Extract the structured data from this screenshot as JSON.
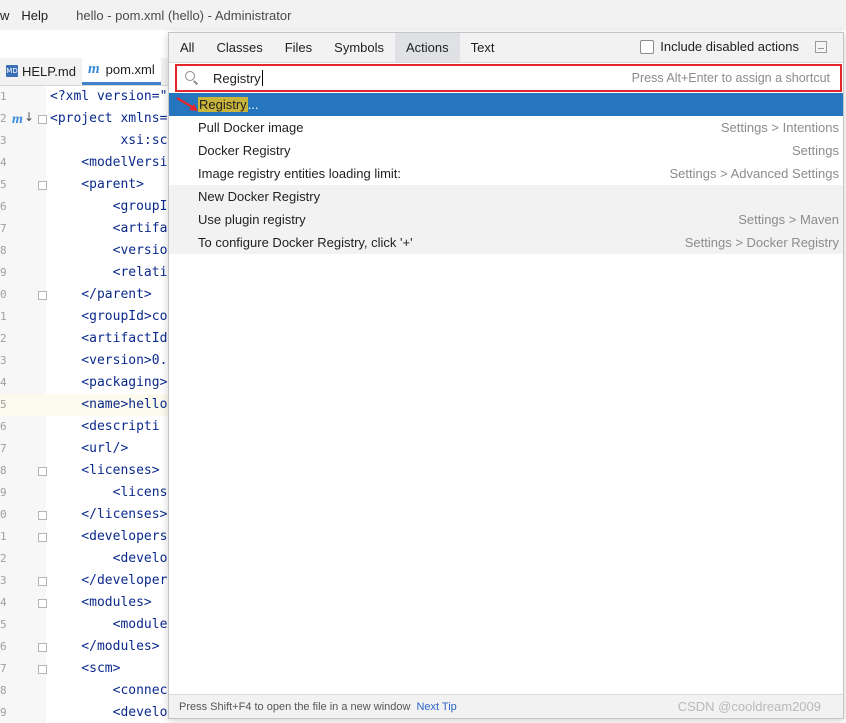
{
  "window": {
    "menus": [
      "w",
      "Help"
    ],
    "title": "hello - pom.xml (hello) - Administrator"
  },
  "editor_tabs": [
    {
      "icon": "md",
      "label": "HELP.md"
    },
    {
      "icon": "m",
      "label": "pom.xml"
    }
  ],
  "code_lines": [
    {
      "ln": "1",
      "text": "<?xml version=\""
    },
    {
      "ln": "2",
      "text": "<project xmlns="
    },
    {
      "ln": "3",
      "text": "         xsi:sc"
    },
    {
      "ln": "4",
      "text": "    <modelVersi"
    },
    {
      "ln": "5",
      "text": "    <parent>"
    },
    {
      "ln": "6",
      "text": "        <groupI"
    },
    {
      "ln": "7",
      "text": "        <artifa"
    },
    {
      "ln": "8",
      "text": "        <versio"
    },
    {
      "ln": "9",
      "text": "        <relati"
    },
    {
      "ln": "0",
      "text": "    </parent>"
    },
    {
      "ln": "1",
      "text": "    <groupId>co"
    },
    {
      "ln": "2",
      "text": "    <artifactId"
    },
    {
      "ln": "3",
      "text": "    <version>0."
    },
    {
      "ln": "4",
      "text": "    <packaging>"
    },
    {
      "ln": "5",
      "text": "    <name>hello"
    },
    {
      "ln": "6",
      "text": "    <descripti"
    },
    {
      "ln": "7",
      "text": "    <url/>"
    },
    {
      "ln": "8",
      "text": "    <licenses>"
    },
    {
      "ln": "9",
      "text": "        <licens"
    },
    {
      "ln": "0",
      "text": "    </licenses>"
    },
    {
      "ln": "1",
      "text": "    <developers"
    },
    {
      "ln": "2",
      "text": "        <develo"
    },
    {
      "ln": "3",
      "text": "    </developer"
    },
    {
      "ln": "4",
      "text": "    <modules>"
    },
    {
      "ln": "5",
      "text": "        <module"
    },
    {
      "ln": "6",
      "text": "    </modules>"
    },
    {
      "ln": "7",
      "text": "    <scm>"
    },
    {
      "ln": "8",
      "text": "        <connec"
    },
    {
      "ln": "9",
      "text": "        <develo"
    }
  ],
  "popup": {
    "tabs": [
      "All",
      "Classes",
      "Files",
      "Symbols",
      "Actions",
      "Text"
    ],
    "active_tab": "Actions",
    "include_disabled_label": "Include disabled actions",
    "search_value": "Registry",
    "search_hint": "Press Alt+Enter to assign a shortcut",
    "results": [
      {
        "match": "Registry",
        "tail": "...",
        "hint": ""
      },
      {
        "label": "Pull Docker image",
        "hint": "Settings > Intentions"
      },
      {
        "label": "Docker Registry",
        "hint": "Settings"
      },
      {
        "label": "Image registry entities loading limit:",
        "hint": "Settings > Advanced Settings"
      },
      {
        "label": "New Docker Registry",
        "hint": ""
      },
      {
        "label": "Use plugin registry",
        "hint": "Settings > Maven"
      },
      {
        "label": "To configure Docker Registry, click '+'",
        "hint": "Settings > Docker Registry"
      }
    ],
    "footer_text": "Press Shift+F4 to open the file in a new window",
    "footer_link": "Next Tip"
  },
  "watermark": "CSDN @cooldream2009",
  "colors": {
    "selection": "#2675bf",
    "highlight_box": "#e5272c",
    "match_highlight": "#c8b53a"
  }
}
